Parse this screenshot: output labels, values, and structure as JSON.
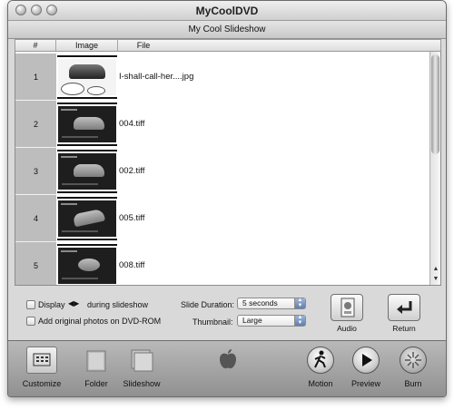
{
  "window": {
    "title": "MyCoolDVD"
  },
  "slideshow": {
    "title": "My Cool Slideshow"
  },
  "columns": {
    "number": "#",
    "image": "Image",
    "file": "File"
  },
  "rows": [
    {
      "number": "1",
      "file": "I-shall-call-her....jpg",
      "thumb": "light"
    },
    {
      "number": "2",
      "file": "004.tiff",
      "thumb": "dark"
    },
    {
      "number": "3",
      "file": "002.tiff",
      "thumb": "dark"
    },
    {
      "number": "4",
      "file": "005.tiff",
      "thumb": "dark"
    },
    {
      "number": "5",
      "file": "008.tiff",
      "thumb": "dark"
    }
  ],
  "options": {
    "display_label_prefix": "Display",
    "display_label_suffix": "during slideshow",
    "add_original_label": "Add original photos on DVD-ROM",
    "slide_duration_label": "Slide Duration:",
    "slide_duration_value": "5 seconds",
    "thumbnail_label": "Thumbnail:",
    "thumbnail_value": "Large",
    "audio_label": "Audio",
    "return_label": "Return"
  },
  "toolbar": {
    "customize": "Customize",
    "folder": "Folder",
    "slideshow": "Slideshow",
    "motion": "Motion",
    "preview": "Preview",
    "burn": "Burn"
  }
}
